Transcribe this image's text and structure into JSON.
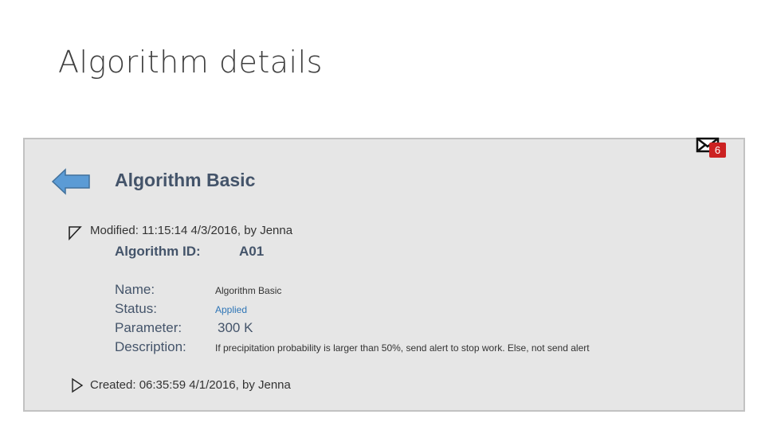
{
  "page": {
    "title": "Algorithm details"
  },
  "notifications": {
    "count": "6",
    "icon": "mail-icon",
    "badge_color": "#cc2222"
  },
  "panel": {
    "heading": "Algorithm Basic",
    "back_icon": "arrow-left-icon",
    "accent_color": "#5b9bd5",
    "modified": "Modified: 11:15:14 4/3/2016, by Jenna",
    "created": "Created: 06:35:59 4/1/2016, by Jenna",
    "id_label": "Algorithm ID:",
    "id_value": "A01",
    "fields": [
      {
        "label": "Name:",
        "value": "Algorithm Basic"
      },
      {
        "label": "Status:",
        "value": "Applied"
      },
      {
        "label": "Parameter:",
        "value": "300 K"
      },
      {
        "label": "Description:",
        "value": "If precipitation probability is larger than 50%, send alert to stop work. Else, not send alert"
      }
    ]
  }
}
